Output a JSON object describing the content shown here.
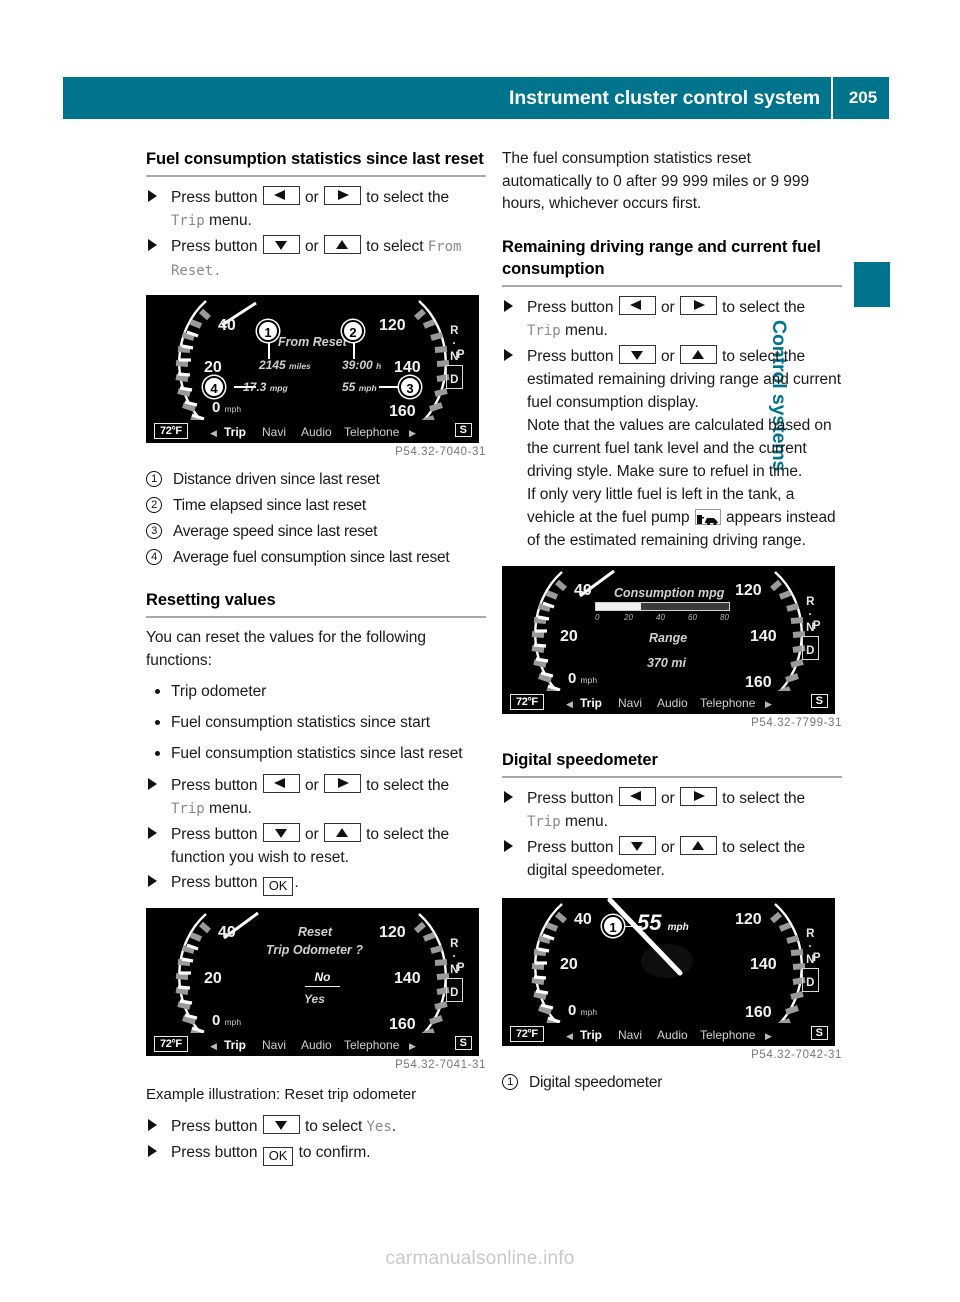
{
  "header": {
    "title": "Instrument cluster control system",
    "page_number": "205"
  },
  "side_tab": {
    "section_title": "Control systems"
  },
  "left_column": {
    "heading1": "Fuel consumption statistics since last reset",
    "steps1": [
      {
        "pre": "Press button",
        "key1": "left-arrow",
        "mid": "or",
        "key2": "right-arrow",
        "post": "to select the",
        "display": "Trip",
        "tail": "menu."
      },
      {
        "pre": "Press button",
        "key1": "down-arrow",
        "mid": "or",
        "key2": "up-arrow",
        "post": "to select",
        "display": "From Reset",
        "tail": "."
      }
    ],
    "figure1": {
      "code": "P54.32-7040-31",
      "left_scale": [
        "40",
        "20"
      ],
      "right_scale": [
        "120",
        "140",
        "160"
      ],
      "speed_readout": "0",
      "speed_unit": "mph",
      "title": "From Reset",
      "value_distance": "2145",
      "unit_distance": "miles",
      "value_time": "39:00",
      "unit_time": "h",
      "value_consumption": "17.3",
      "unit_consumption": "mpg",
      "value_avg_speed": "55",
      "unit_avg_speed": "mph",
      "callouts": [
        "1",
        "2",
        "3",
        "4"
      ],
      "temp": "72°F",
      "menu": [
        "Trip",
        "Navi",
        "Audio",
        "Telephone"
      ],
      "active_menu": "Trip",
      "badge": "S",
      "gear_letters": [
        "R",
        "N",
        "P"
      ],
      "gear_selected": "D"
    },
    "legend1": [
      {
        "num": "1",
        "text": "Distance driven since last reset"
      },
      {
        "num": "2",
        "text": "Time elapsed since last reset"
      },
      {
        "num": "3",
        "text": "Average speed since last reset"
      },
      {
        "num": "4",
        "text": "Average fuel consumption since last reset"
      }
    ],
    "heading2": "Resetting values",
    "intro2": "You can reset the values for the following functions:",
    "bullets2": [
      "Trip odometer",
      "Fuel consumption statistics since start",
      "Fuel consumption statistics since last reset"
    ],
    "steps2": [
      {
        "pre": "Press button",
        "key1": "left-arrow",
        "mid": "or",
        "key2": "right-arrow",
        "post": "to select the",
        "display": "Trip",
        "tail": "menu."
      },
      {
        "pre": "Press button",
        "key1": "down-arrow",
        "mid": "or",
        "key2": "up-arrow",
        "post": "to select the function you wish to reset."
      },
      {
        "pre": "Press button",
        "key1": "ok",
        "post": "."
      }
    ],
    "figure2": {
      "code": "P54.32-7041-31",
      "left_scale": [
        "40",
        "20"
      ],
      "right_scale": [
        "120",
        "140",
        "160"
      ],
      "speed_readout": "0",
      "speed_unit": "mph",
      "title_line1": "Reset",
      "title_line2": "Trip Odometer ?",
      "option_selected": "No",
      "option_other": "Yes",
      "temp": "72°F",
      "menu": [
        "Trip",
        "Navi",
        "Audio",
        "Telephone"
      ],
      "active_menu": "Trip",
      "badge": "S",
      "gear_letters": [
        "R",
        "N",
        "P"
      ],
      "gear_selected": "D"
    },
    "figure2_caption": "Example illustration: Reset trip odometer",
    "steps3": [
      {
        "pre": "Press button",
        "key1": "down-arrow",
        "post": "to select",
        "display": "Yes",
        "tail": "."
      },
      {
        "pre": "Press button",
        "key1": "ok",
        "post": "to confirm."
      }
    ]
  },
  "right_column": {
    "para1": "The fuel consumption statistics reset automatically to 0 after 99 999 miles or 9 999 hours, whichever occurs first.",
    "heading1": "Remaining driving range and current fuel consumption",
    "steps1": [
      {
        "pre": "Press button",
        "key1": "left-arrow",
        "mid": "or",
        "key2": "right-arrow",
        "post": "to select the",
        "display": "Trip",
        "tail": "menu."
      },
      {
        "pre": "Press button",
        "key1": "down-arrow",
        "mid": "or",
        "key2": "up-arrow",
        "post": "to select the estimated remaining driving range and current fuel consumption display."
      }
    ],
    "note1": "Note that the values are calculated based on the current fuel tank level and the current driving style. Make sure to refuel in time.",
    "note2_pre": "If only very little fuel is left in the tank, a vehicle at the fuel pump",
    "note2_post": "appears instead of the estimated remaining driving range.",
    "figure1": {
      "code": "P54.32-7799-31",
      "left_scale": [
        "40",
        "20"
      ],
      "right_scale": [
        "120",
        "140",
        "160"
      ],
      "speed_readout": "0",
      "speed_unit": "mph",
      "title": "Consumption mpg",
      "bar_ticks": [
        "0",
        "20",
        "40",
        "60",
        "80"
      ],
      "bar_value": 27,
      "bar_max": 80,
      "range_label": "Range",
      "range_value": "370 mi",
      "temp": "72°F",
      "menu": [
        "Trip",
        "Navi",
        "Audio",
        "Telephone"
      ],
      "active_menu": "Trip",
      "badge": "S",
      "gear_letters": [
        "R",
        "N",
        "P"
      ],
      "gear_selected": "D"
    },
    "heading2": "Digital speedometer",
    "steps2": [
      {
        "pre": "Press button",
        "key1": "left-arrow",
        "mid": "or",
        "key2": "right-arrow",
        "post": "to select the",
        "display": "Trip",
        "tail": "menu."
      },
      {
        "pre": "Press button",
        "key1": "down-arrow",
        "mid": "or",
        "key2": "up-arrow",
        "post": "to select the digital speedometer."
      }
    ],
    "figure2": {
      "code": "P54.32-7042-31",
      "left_scale": [
        "40",
        "20"
      ],
      "right_scale": [
        "120",
        "140",
        "160"
      ],
      "speed_readout": "0",
      "speed_unit": "mph",
      "digital_speed": "55",
      "digital_unit": "mph",
      "callout": "1",
      "temp": "72°F",
      "menu": [
        "Trip",
        "Navi",
        "Audio",
        "Telephone"
      ],
      "active_menu": "Trip",
      "badge": "S",
      "gear_letters": [
        "R",
        "N",
        "P"
      ],
      "gear_selected": "D"
    },
    "legend2": [
      {
        "num": "1",
        "text": "Digital speedometer"
      }
    ]
  },
  "watermark": "carmanualsonline.info",
  "colors": {
    "accent_teal": "#00748c",
    "rule_gray": "#a8a8a8",
    "display_gray": "#8a8a8a"
  }
}
